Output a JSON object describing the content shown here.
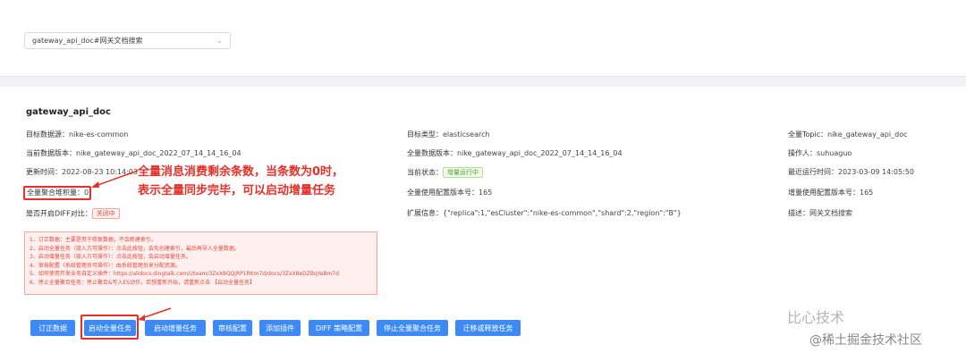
{
  "search": {
    "value": "gateway_api_doc#网关文档搜索"
  },
  "detail": {
    "title": "gateway_api_doc",
    "col1": [
      {
        "label": "目标数据源：",
        "value": "nike-es-common"
      },
      {
        "label": "当前数据版本：",
        "value": "nike_gateway_api_doc_2022_07_14_14_16_04"
      },
      {
        "label": "更新时间：",
        "value": "2022-08-23 10:14:03"
      },
      {
        "label": "全量聚合堆积量：",
        "value": "0"
      },
      {
        "label": "是否开启DIFF对比：",
        "value": "关闭中"
      }
    ],
    "col2": [
      {
        "label": "目标类型：",
        "value": "elasticsearch"
      },
      {
        "label": "全量数据版本：",
        "value": "nike_gateway_api_doc_2022_07_14_14_16_04"
      },
      {
        "label": "当前状态：",
        "value": "增量运行中"
      },
      {
        "label": "全量使用配置版本号：",
        "value": "165"
      },
      {
        "label": "扩展信息：",
        "value": "{\"replica\":1,\"esCluster\":\"nike-es-common\",\"shard\":2,\"region\":\"B\"}"
      }
    ],
    "col3": [
      {
        "label": "全量Topic：",
        "value": "nike_gateway_api_doc"
      },
      {
        "label": "操作人：",
        "value": "suhuaguo"
      },
      {
        "label": "最近运行时间：",
        "value": "2023-03-09 14:05:50"
      },
      {
        "label": "增量使用配置版本号：",
        "value": "165"
      },
      {
        "label": "描述：",
        "value": "网关文档搜索"
      }
    ]
  },
  "annotation": {
    "line1": "全量消息消费剩余条数，当条数为0时，",
    "line2": "表示全量同步完毕，可以启动增量任务"
  },
  "notice": [
    "1、订正数据：主要是用于修复数据，不会新建索引。",
    "2、启动全量任务（接入方可操作）：点击此按钮，会先创建索引，最后再导入全量数据。",
    "3、启动增量任务（接入方可操作）：点击此按钮，会启动增量任务。",
    "4、审核配置（系统管理员可操作）：由系统管理员来分配资源。",
    "5、如何使用开发业务自定义插件：https://alidocs.dingtalk.com/i/team/3ZxX8QQjRP1RKm7d/docs/3ZxX8eDZBqYaBm7d",
    "6、停止全量聚合任务：停止聚合&写入ES动作，若想重新开始，请重新点击 【启动全量任务】"
  ],
  "buttons": [
    "订正数据",
    "启动全量任务",
    "启动增量任务",
    "审核配置",
    "添加插件",
    "DIFF 策略配置",
    "停止全量聚合任务",
    "迁移或释放任务"
  ],
  "watermark": {
    "logo": "比心技术",
    "text": "@稀土掘金技术社区"
  },
  "colors": {
    "primary": "#3d8af7",
    "annotation": "#e5302a"
  }
}
